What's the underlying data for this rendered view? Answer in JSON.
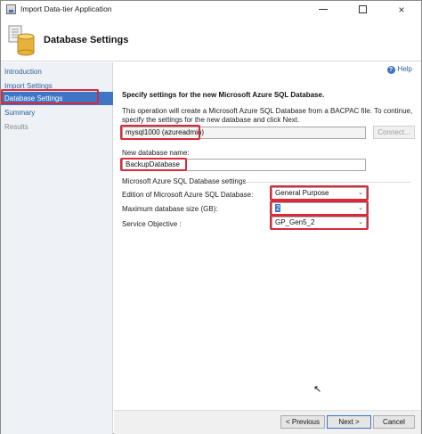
{
  "window": {
    "title": "Import Data-tier Application",
    "minimize_label": "minimize",
    "maximize_label": "maximize",
    "close_label": "×"
  },
  "header": {
    "title": "Database Settings",
    "icon": "database-wizard-icon"
  },
  "sidebar": {
    "items": [
      {
        "label": "Introduction",
        "state": "link"
      },
      {
        "label": "Import Settings",
        "state": "link"
      },
      {
        "label": "Database Settings",
        "state": "active"
      },
      {
        "label": "Summary",
        "state": "link"
      },
      {
        "label": "Results",
        "state": "disabled"
      }
    ]
  },
  "main": {
    "help_label": "Help",
    "heading": "Specify settings for the new Microsoft Azure SQL Database.",
    "description": "This operation will create a Microsoft Azure SQL Database from a BACPAC file. To continue, specify the settings for the new database and click Next.",
    "server_value": "mysql1000 (azureadmin)",
    "connect_label": "Connect...",
    "new_db_label": "New database name:",
    "new_db_value": "BackupDatabase",
    "group_title": "Microsoft Azure SQL Database settings",
    "edition_label": "Edition of Microsoft Azure SQL Database:",
    "edition_value": "General Purpose",
    "max_size_label": "Maximum database size (GB):",
    "max_size_value": "2",
    "service_objective_label": "Service Objective :",
    "service_objective_value": "GP_Gen5_2"
  },
  "footer": {
    "previous_label": "< Previous",
    "next_label": "Next >",
    "cancel_label": "Cancel"
  },
  "colors": {
    "accent": "#3e75c4",
    "highlight": "#d72a3a",
    "sidebar_bg": "#eef1f5"
  }
}
